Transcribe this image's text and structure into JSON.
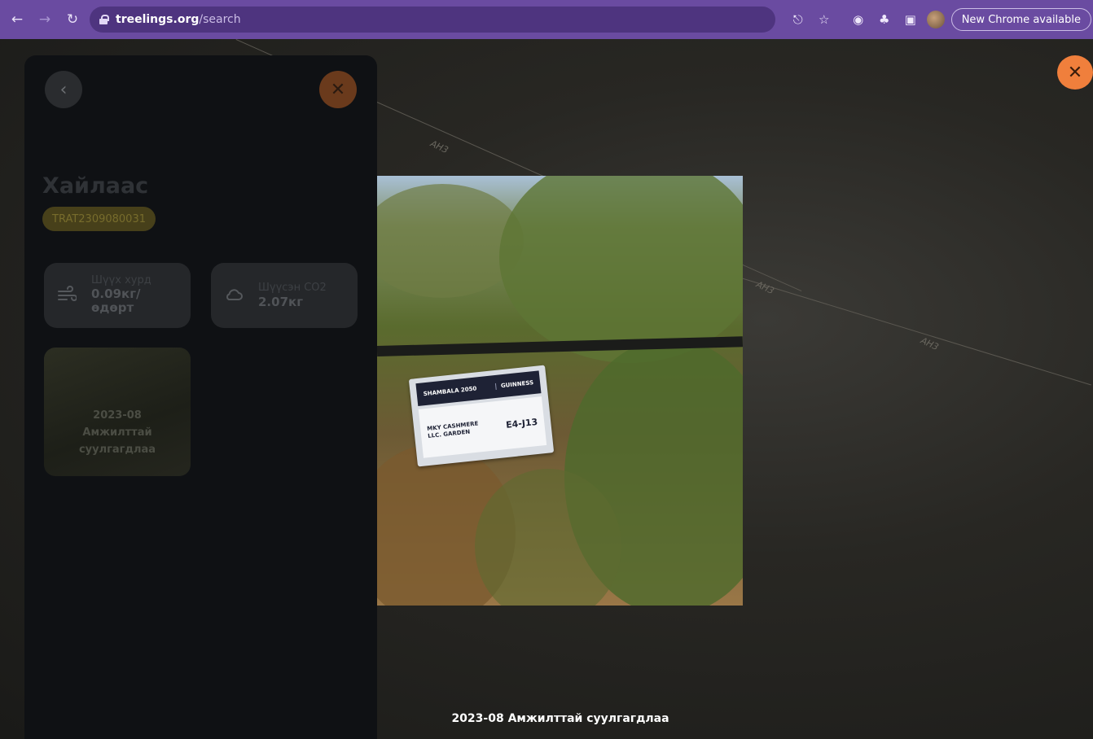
{
  "browser": {
    "url_host": "treelings.org",
    "url_path": "/search",
    "update_chip": "New Chrome available"
  },
  "map": {
    "road_labels": [
      "AH3",
      "AH3",
      "AH3"
    ]
  },
  "panel": {
    "species": "Хайлаас",
    "code": "TRAT2309080031",
    "stats": [
      {
        "label": "Шүүх хурд",
        "value": "0.09кг/ өдөрт",
        "icon": "wind-icon"
      },
      {
        "label": "Шүүсэн CO2",
        "value": "2.07кг",
        "icon": "cloud-icon"
      }
    ],
    "gallery": [
      {
        "line1": "2023-08",
        "line2": "Амжилттай",
        "line3": "суулгагдлаа"
      }
    ]
  },
  "photo": {
    "sign_brand": "SHAMBALA 2050",
    "sign_guinness": "GUINNESS",
    "sign_org": "MKY CASHMERE LLC. GARDEN",
    "sign_code": "E4-J13"
  },
  "caption": "2023-08 Амжилттай суулгагдлаа",
  "colors": {
    "toolbar": "#6a4ba1",
    "accent": "#f07f3c",
    "panel": "#0f1114"
  }
}
